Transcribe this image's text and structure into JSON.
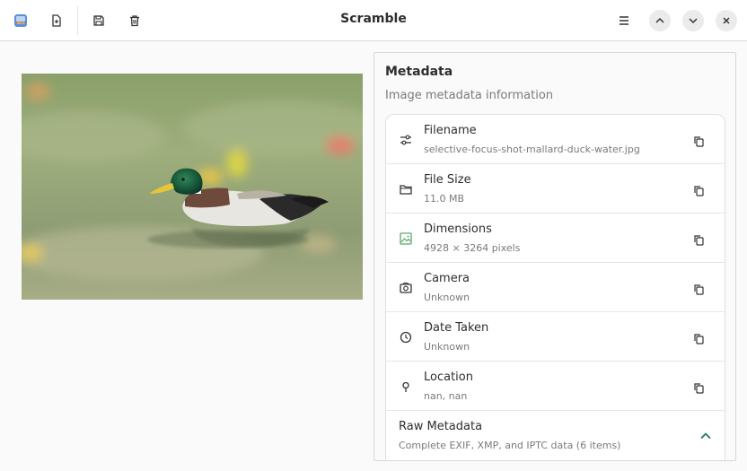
{
  "header": {
    "title": "Scramble",
    "icons": [
      "app-image-icon",
      "open-file-icon",
      "save-icon",
      "trash-icon",
      "menu-icon",
      "chevron-up-icon",
      "chevron-down-icon",
      "close-icon"
    ]
  },
  "image": {
    "description_icon": "mallard-duck-photo"
  },
  "metadata": {
    "title": "Metadata",
    "subtitle": "Image metadata information",
    "rows": [
      {
        "label": "Filename",
        "value": "selective-focus-shot-mallard-duck-water.jpg",
        "icon": "sliders-icon"
      },
      {
        "label": "File Size",
        "value": "11.0 MB",
        "icon": "folder-icon"
      },
      {
        "label": "Dimensions",
        "value": "4928 × 3264 pixels",
        "icon": "image-icon"
      },
      {
        "label": "Camera",
        "value": "Unknown",
        "icon": "camera-icon"
      },
      {
        "label": "Date Taken",
        "value": "Unknown",
        "icon": "clock-icon"
      },
      {
        "label": "Location",
        "value": "nan, nan",
        "icon": "location-pin-icon"
      }
    ],
    "raw": {
      "label": "Raw Metadata",
      "value": "Complete EXIF, XMP, and IPTC data (6 items)"
    }
  },
  "colors": {
    "accent": "#1c7a6b",
    "dimensions_icon": "#5aa86a"
  }
}
